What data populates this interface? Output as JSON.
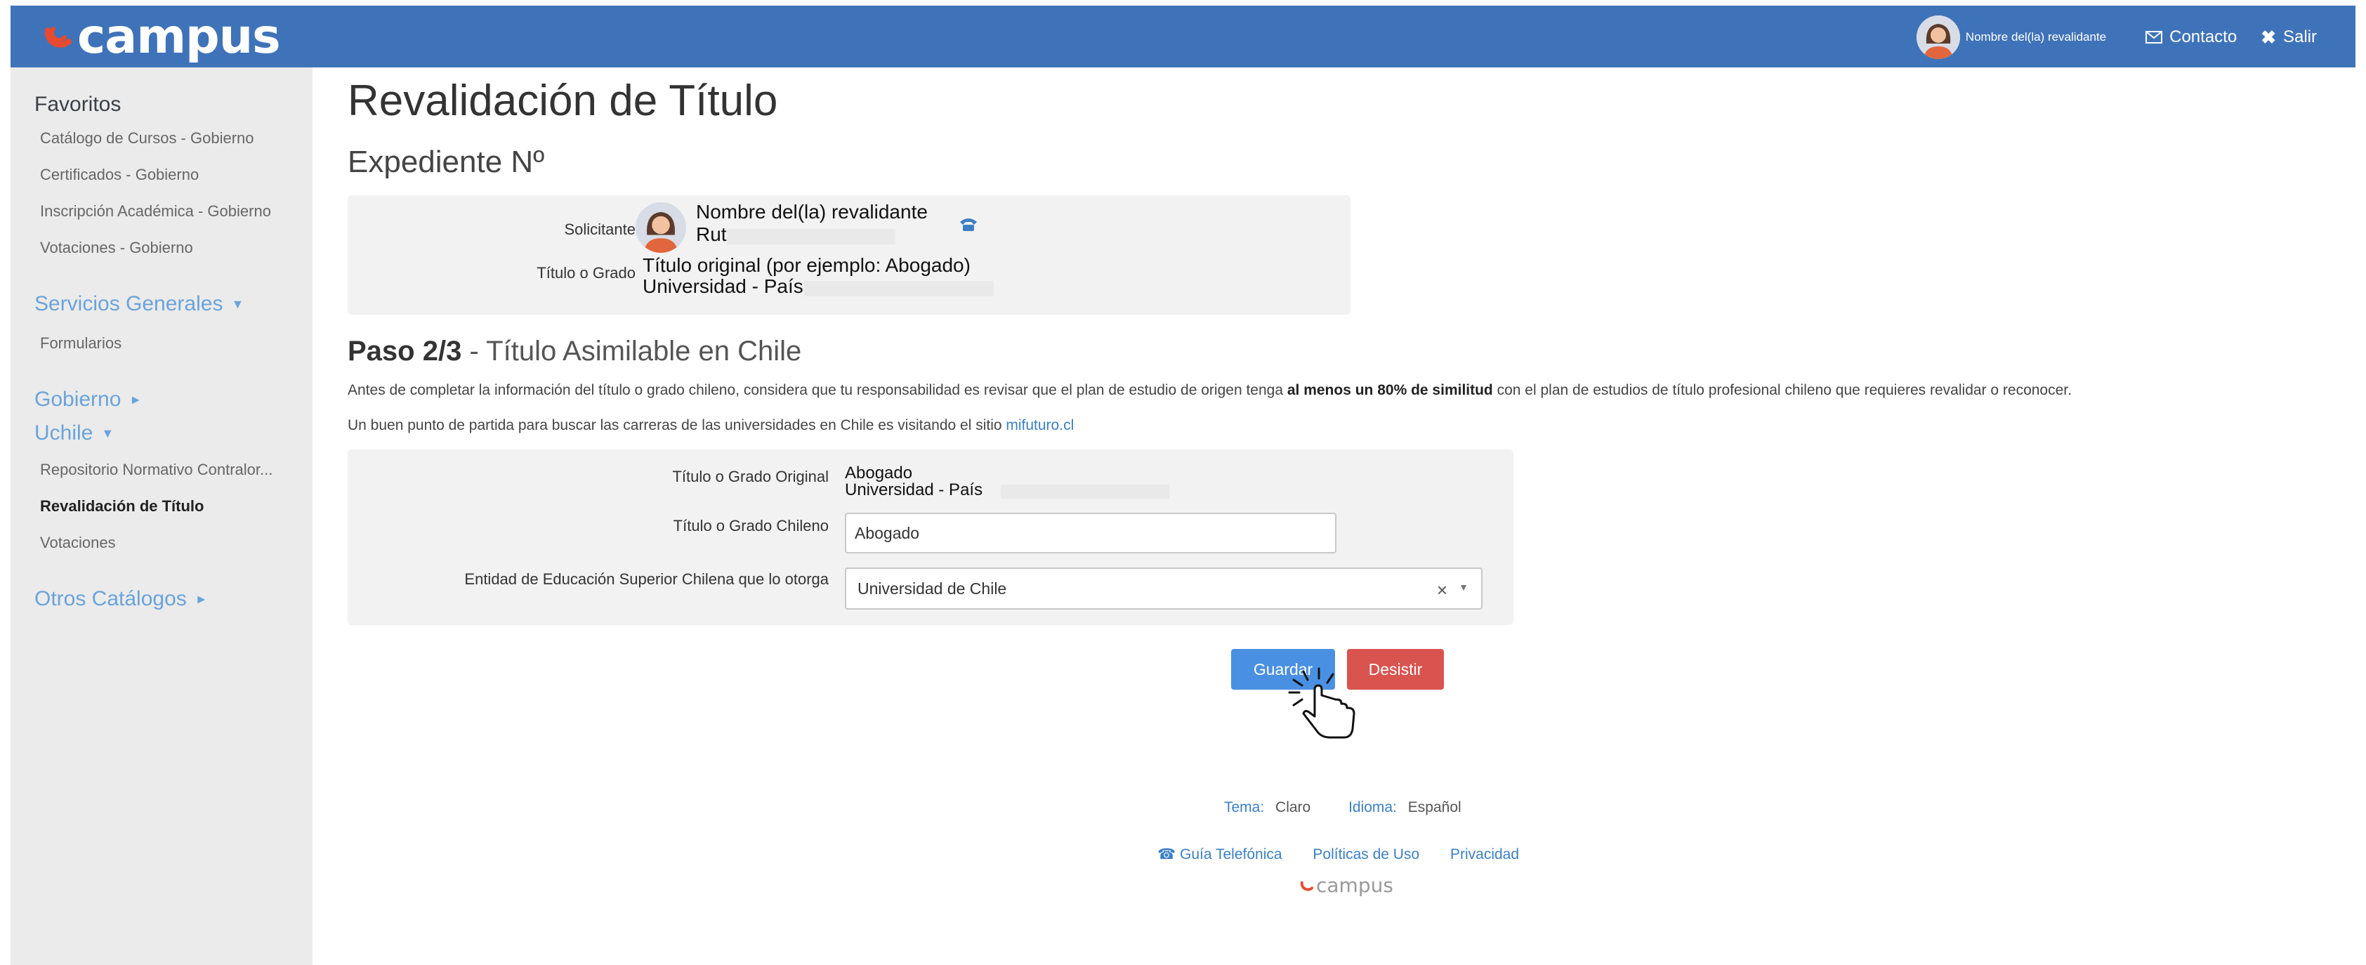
{
  "header": {
    "logo_text": "campus",
    "user_name": "Nombre del(la) revalidante",
    "contact_label": "Contacto",
    "exit_label": "Salir",
    "bg_color": "#3f73b9"
  },
  "sidebar": {
    "favoritos_title": "Favoritos",
    "favoritos": [
      "Catálogo de Cursos - Gobierno",
      "Certificados - Gobierno",
      "Inscripción Académica - Gobierno",
      "Votaciones - Gobierno"
    ],
    "servicios_title": "Servicios Generales",
    "servicios": [
      "Formularios"
    ],
    "gobierno_title": "Gobierno",
    "uchile_title": "Uchile",
    "uchile_items": [
      "Repositorio Normativo Contralor...",
      "Revalidación de Título",
      "Votaciones"
    ],
    "otros_title": "Otros Catálogos"
  },
  "main": {
    "title": "Revalidación de Título",
    "expediente": "Expediente Nº",
    "solicitante_label": "Solicitante",
    "solicitante_name": "Nombre del(la) revalidante",
    "solicitante_rut": "Rut",
    "titulo_label": "Título o Grado",
    "titulo_value": "Título original (por ejemplo: Abogado)",
    "titulo_univ": "Universidad - País",
    "step_bold": "Paso 2/3",
    "step_sep": " - ",
    "step_title": "Título Asimilable en Chile",
    "para1_a": "Antes de completar la información del título o grado chileno, considera que tu responsabilidad es revisar que el plan de estudio de origen tenga ",
    "para1_b": "al menos un 80% de similitud",
    "para1_c": " con el plan de estudios de título profesional chileno que requieres revalidar o reconocer.",
    "para2_a": "Un buen punto de partida para buscar las carreras de las universidades en Chile es visitando el sitio ",
    "para2_link": "mifuturo.cl",
    "form": {
      "original_label": "Título o Grado Original",
      "original_value": "Abogado",
      "original_univ": "Universidad - País",
      "chileno_label": "Título o Grado Chileno",
      "chileno_value": "Abogado",
      "entidad_label": "Entidad de Educación Superior Chilena que lo otorga",
      "entidad_value": "Universidad de Chile"
    },
    "save_label": "Guardar",
    "cancel_label": "Desistir"
  },
  "footer": {
    "tema_label": "Tema:",
    "tema_value": "Claro",
    "idioma_label": "Idioma:",
    "idioma_value": "Español",
    "guia": "Guía Telefónica",
    "politicas": "Políticas de Uso",
    "privacidad": "Privacidad",
    "logo_text": "campus"
  }
}
